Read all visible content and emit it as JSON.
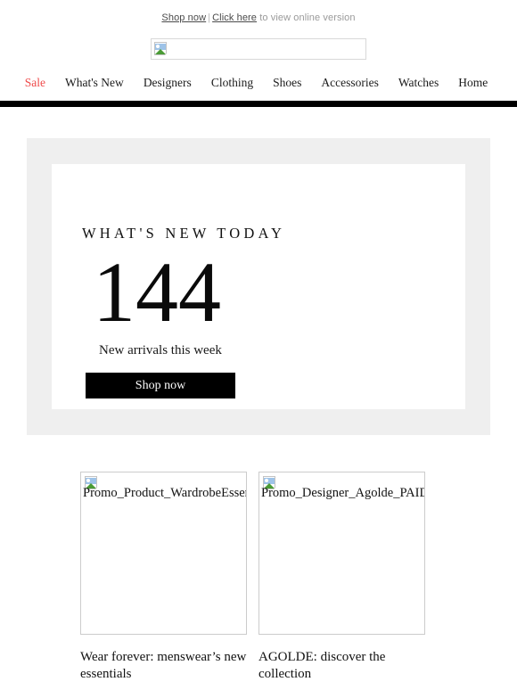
{
  "preheader": {
    "shop_now": "Shop now",
    "separator": "|",
    "click_here": "Click here",
    "tail": "to view online version"
  },
  "logo": {
    "icon": "broken-image-icon",
    "alt": ""
  },
  "nav": {
    "items": [
      {
        "label": "Sale",
        "color": "#ef4b4b"
      },
      {
        "label": "What's New",
        "color": "#1a1a1a"
      },
      {
        "label": "Designers",
        "color": "#1a1a1a"
      },
      {
        "label": "Clothing",
        "color": "#1a1a1a"
      },
      {
        "label": "Shoes",
        "color": "#1a1a1a"
      },
      {
        "label": "Accessories",
        "color": "#1a1a1a"
      },
      {
        "label": "Watches",
        "color": "#1a1a1a"
      },
      {
        "label": "Home",
        "color": "#1a1a1a"
      }
    ]
  },
  "hero": {
    "eyebrow": "WHAT'S NEW TODAY",
    "number": "144",
    "subtitle": "New arrivals this week",
    "cta_label": "Shop now",
    "panel_color": "#efefef",
    "card_color": "#ffffff",
    "cta_bg": "#000000",
    "cta_text_color": "#ffffff"
  },
  "products": [
    {
      "image_alt": "Promo_Product_WardrobeEssentials",
      "icon": "broken-image-icon",
      "caption": "Wear forever: menswear’s new essentials"
    },
    {
      "image_alt": "Promo_Designer_Agolde_PAID",
      "icon": "broken-image-icon",
      "caption": "AGOLDE: discover the collection"
    }
  ]
}
